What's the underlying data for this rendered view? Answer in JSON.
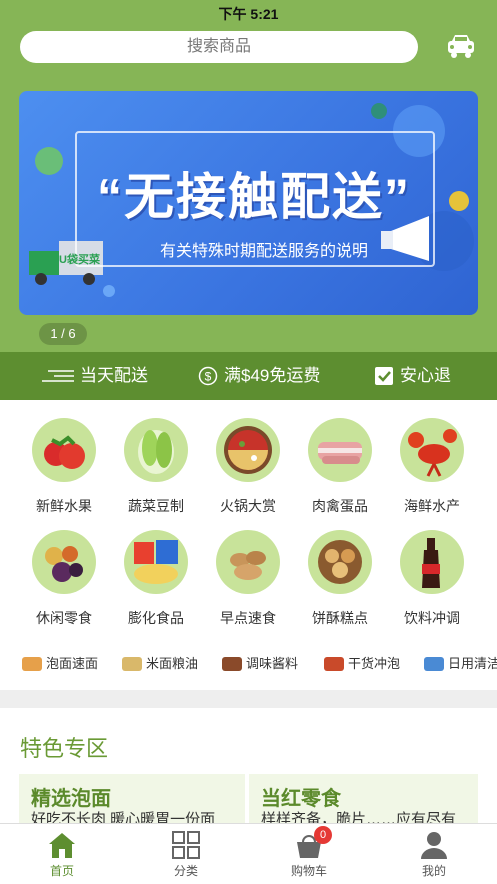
{
  "status_bar": {
    "time": "下午 5:21"
  },
  "header": {
    "search_placeholder": "搜索商品"
  },
  "banner": {
    "title": "“无接触配送”",
    "subtitle": "有关特殊时期配送服务的说明",
    "truck_brand": "U袋买菜",
    "pager": "1 / 6"
  },
  "service_bar": [
    {
      "icon": "lines-icon",
      "label": "当天配送"
    },
    {
      "icon": "dollar-icon",
      "label": "满$49免运费"
    },
    {
      "icon": "check-icon",
      "label": "安心退"
    }
  ],
  "categories": [
    {
      "label": "新鲜水果",
      "icon": "strawberry-icon"
    },
    {
      "label": "蔬菜豆制",
      "icon": "cabbage-icon"
    },
    {
      "label": "火锅大赏",
      "icon": "hotpot-icon"
    },
    {
      "label": "肉禽蛋品",
      "icon": "meat-icon"
    },
    {
      "label": "海鲜水产",
      "icon": "lobster-icon"
    },
    {
      "label": "休闲零食",
      "icon": "snack-icon"
    },
    {
      "label": "膨化食品",
      "icon": "chips-icon"
    },
    {
      "label": "早点速食",
      "icon": "breakfast-icon"
    },
    {
      "label": "饼酥糕点",
      "icon": "pastry-icon"
    },
    {
      "label": "饮料冲调",
      "icon": "cola-icon"
    }
  ],
  "quick_links": [
    {
      "label": "泡面速面"
    },
    {
      "label": "米面粮油"
    },
    {
      "label": "调味酱料"
    },
    {
      "label": "干货冲泡"
    },
    {
      "label": "日用清洁"
    }
  ],
  "featured": {
    "title": "特色专区",
    "cards": [
      {
        "title": "精选泡面",
        "subtitle": "好吃不长肉 暖心暖胃一份面"
      },
      {
        "title": "当红零食",
        "subtitle": "样样齐备，脆片……应有尽有"
      }
    ]
  },
  "tabbar": {
    "items": [
      {
        "label": "首页",
        "icon": "home-icon",
        "active": true
      },
      {
        "label": "分类",
        "icon": "grid-icon"
      },
      {
        "label": "购物车",
        "icon": "cart-icon",
        "badge": "0"
      },
      {
        "label": "我的",
        "icon": "user-icon"
      }
    ]
  },
  "colors": {
    "brand_green": "#86b556",
    "dark_green": "#5d8e30",
    "banner_blue": "#3a74e0"
  }
}
